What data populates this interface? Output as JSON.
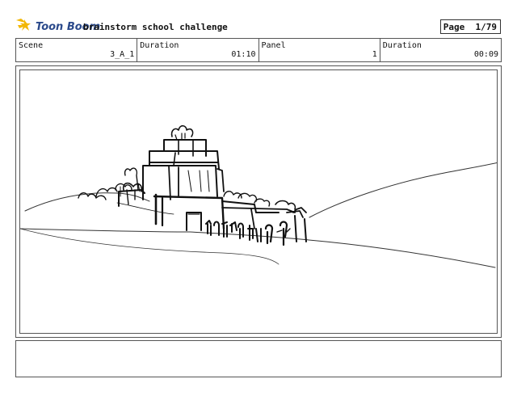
{
  "header": {
    "logo_text": "Toon Boom",
    "project_title": "brainstorm school challenge",
    "page_label": "Page",
    "page_value": "1/79"
  },
  "info": {
    "scene_label": "Scene",
    "scene_value": "3_A_1",
    "duration1_label": "Duration",
    "duration1_value": "01:10",
    "panel_label": "Panel",
    "panel_value": "1",
    "duration2_label": "Duration",
    "duration2_value": "00:09"
  },
  "colors": {
    "logo_icon": "#f2b705",
    "logo_text": "#2b4a8b"
  },
  "panel": {
    "notes": ""
  }
}
